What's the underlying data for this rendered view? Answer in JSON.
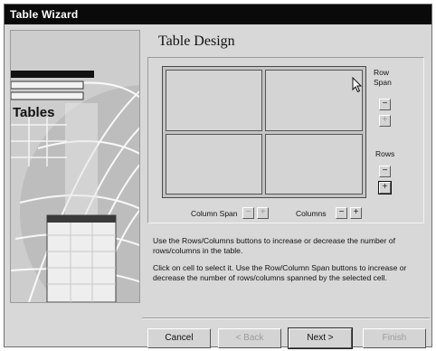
{
  "window": {
    "title": "Table Wizard"
  },
  "art": {
    "caption": "Tables"
  },
  "design": {
    "heading": "Table Design"
  },
  "row_span": {
    "label": "Row Span",
    "up": "−",
    "down": "+"
  },
  "rows": {
    "label": "Rows",
    "minus": "−",
    "plus": "+"
  },
  "column_span": {
    "label": "Column Span",
    "minus": "−",
    "plus": "+"
  },
  "columns": {
    "label": "Columns",
    "minus": "−",
    "plus": "+"
  },
  "help": {
    "line1": "Use the Rows/Columns buttons to increase or decrease the  number of rows/columns in the table.",
    "line2": "Click on cell to select it. Use the Row/Column Span buttons to increase or decrease the number of rows/columns spanned by the selected cell."
  },
  "buttons": {
    "cancel": "Cancel",
    "back": "< Back",
    "next": "Next >",
    "finish": "Finish"
  },
  "colors": {
    "titlebar": "#0a0a0a",
    "face": "#d8d8d8"
  },
  "icons": {
    "cursor": "arrow-cursor-icon"
  }
}
